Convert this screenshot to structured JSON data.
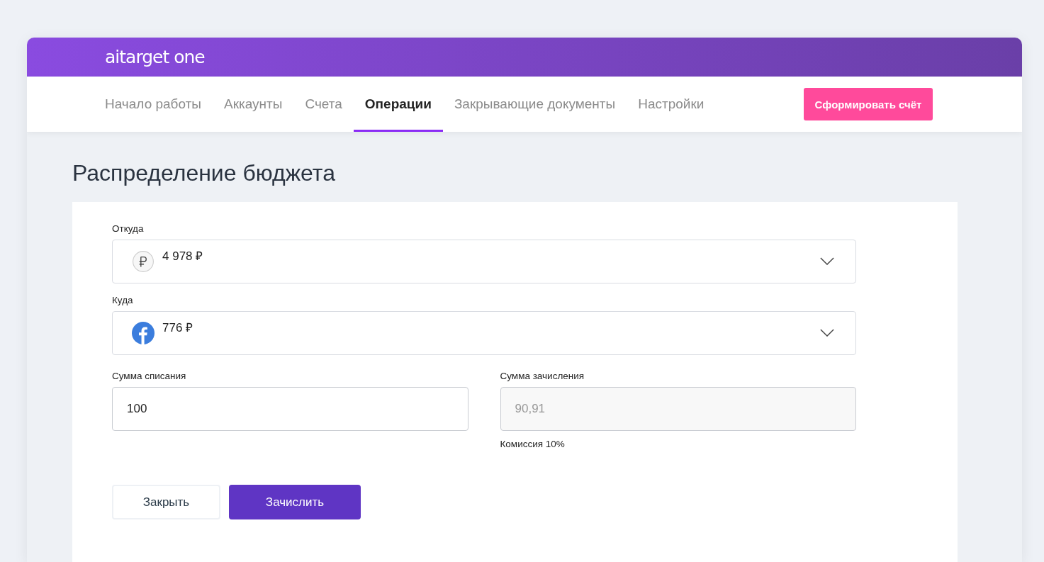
{
  "logo": "aitarget one",
  "tabs": [
    {
      "label": "Начало работы",
      "selected": false
    },
    {
      "label": "Аккаунты",
      "selected": false
    },
    {
      "label": "Счета",
      "selected": false
    },
    {
      "label": "Операции",
      "selected": true
    },
    {
      "label": "Закрывающие документы",
      "selected": false
    },
    {
      "label": "Настройки",
      "selected": false
    }
  ],
  "invoice_button": "Сформировать счёт",
  "page_title": "Распределение бюджета",
  "selects": [
    {
      "label": "Откуда",
      "kind": "currency",
      "value": "4 978 ₽"
    },
    {
      "label": "Куда",
      "kind": "social",
      "value": "776 ₽"
    }
  ],
  "amounts": [
    {
      "label": "Сумма списания",
      "value": "100",
      "disabled": false
    },
    {
      "label": "Сумма зачисления",
      "value": "90,91",
      "disabled": true,
      "note": "Комиссия 10%"
    }
  ],
  "buttons": [
    {
      "label": "Закрыть",
      "kind": "secondary"
    },
    {
      "label": "Зачислить",
      "kind": "primary"
    }
  ]
}
